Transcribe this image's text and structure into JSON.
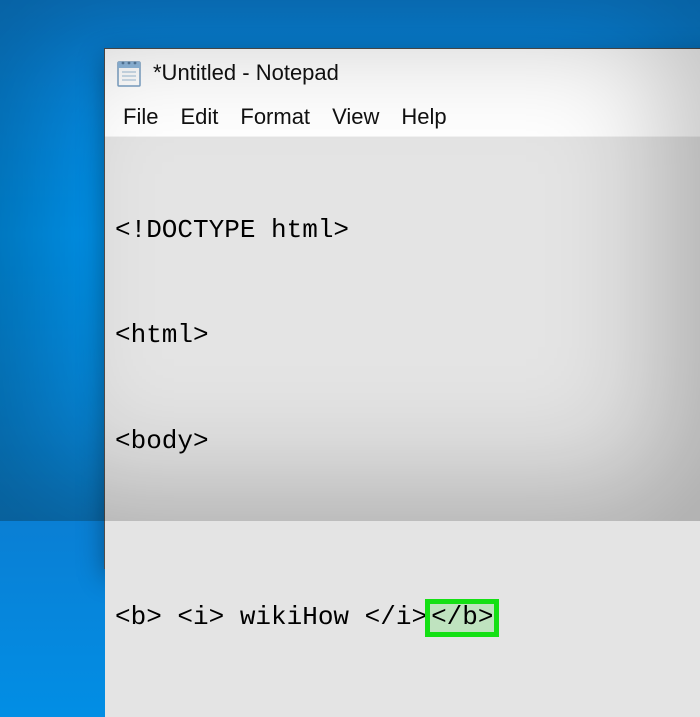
{
  "window": {
    "title": "*Untitled - Notepad"
  },
  "menu": {
    "file": "File",
    "edit": "Edit",
    "format": "Format",
    "view": "View",
    "help": "Help"
  },
  "editor": {
    "line1": "<!DOCTYPE html>",
    "line2": "<html>",
    "line3": "<body>",
    "line4": "",
    "line5_pre": "<b> <i> wikiHow </i>",
    "line5_highlight": "</b>"
  }
}
